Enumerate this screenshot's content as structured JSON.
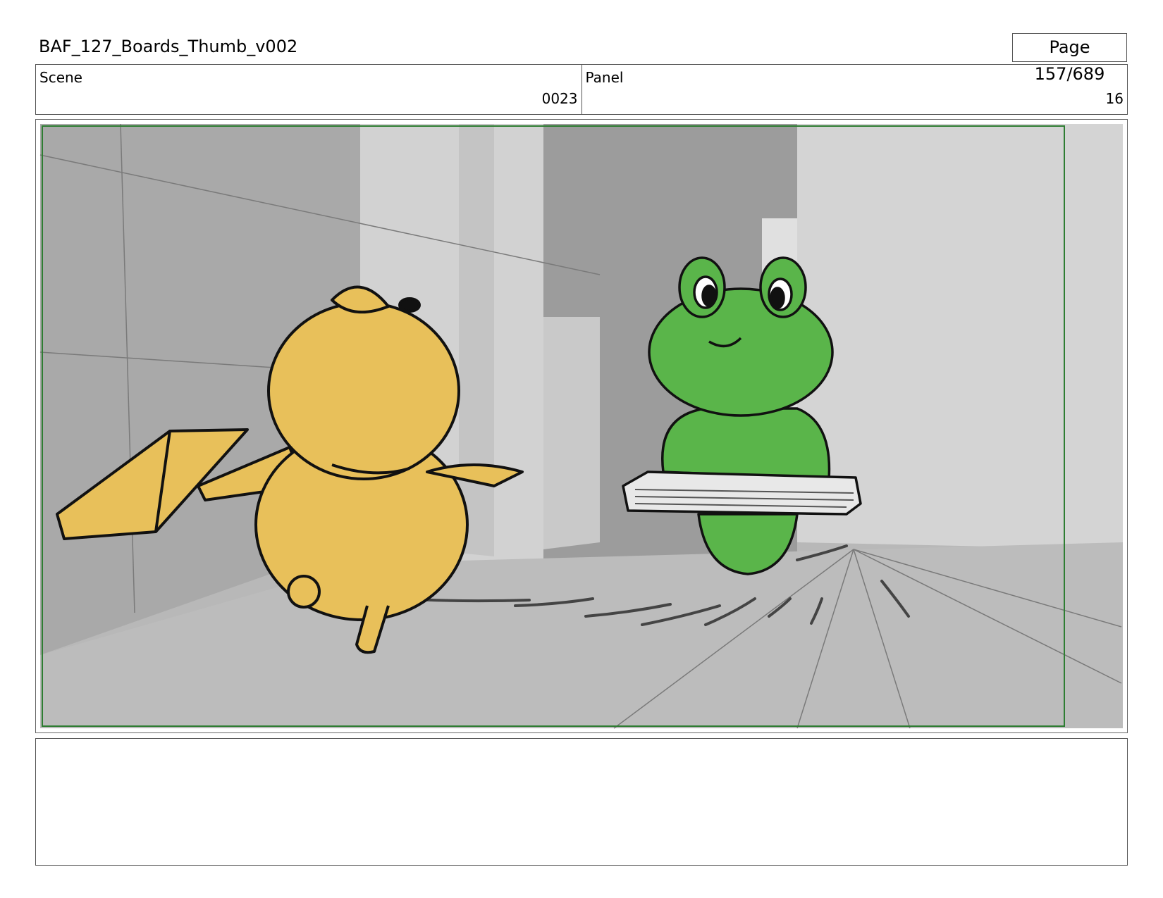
{
  "header": {
    "file_title": "BAF_127_Boards_Thumb_v002",
    "page_label": "Page 157/689"
  },
  "meta": {
    "scene_label": "Scene",
    "scene_value": "0023",
    "panel_label": "Panel",
    "panel_value": "16"
  },
  "colors": {
    "safe_frame": "#2e7d32",
    "duck": "#e8c05a",
    "frog": "#5ab54a",
    "background": "#bdbdbd"
  },
  "notes": {
    "text": ""
  }
}
